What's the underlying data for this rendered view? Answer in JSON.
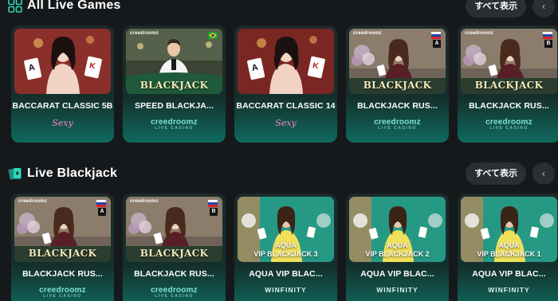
{
  "sections": [
    {
      "title": "All Live Games",
      "icon": "grid-icon",
      "see_all": "すべて表示",
      "nav": "‹",
      "cards": [
        {
          "title": "BACCARAT CLASSIC 5B",
          "provider": "Sexy",
          "provider_type": "sexy",
          "scene": "baccarat"
        },
        {
          "title": "SPEED BLACKJA...",
          "provider": "creedroomz",
          "provider_sub": "LIVE CASINO",
          "provider_type": "creed",
          "scene": "blackjack-dealer",
          "thumb_brand": "creedroomz",
          "flag": "brazil",
          "thumb_logo": "BLACKJACK"
        },
        {
          "title": "BACCARAT CLASSIC 14",
          "provider": "Sexy",
          "provider_type": "sexy",
          "scene": "baccarat2"
        },
        {
          "title": "BLACKJACK RUS...",
          "provider": "creedroomz",
          "provider_sub": "LIVE CASINO",
          "provider_type": "creed",
          "scene": "blackjack-lady",
          "thumb_brand": "creedroomz",
          "flag": "russia",
          "badge": "A",
          "thumb_logo": "BLACKJACK"
        },
        {
          "title": "BLACKJACK RUS...",
          "provider": "creedroomz",
          "provider_sub": "LIVE CASINO",
          "provider_type": "creed",
          "scene": "blackjack-lady",
          "thumb_brand": "creedroomz",
          "flag": "russia",
          "badge": "B",
          "thumb_logo": "BLACKJACK"
        }
      ]
    },
    {
      "title": "Live Blackjack",
      "icon": "cards-icon",
      "see_all": "すべて表示",
      "nav": "‹",
      "cards": [
        {
          "title": "BLACKJACK RUS...",
          "provider": "creedroomz",
          "provider_sub": "LIVE CASINO",
          "provider_type": "creed",
          "scene": "blackjack-lady",
          "thumb_brand": "creedroomz",
          "flag": "russia",
          "badge": "A",
          "thumb_logo": "BLACKJACK"
        },
        {
          "title": "BLACKJACK RUS...",
          "provider": "creedroomz",
          "provider_sub": "LIVE CASINO",
          "provider_type": "creed",
          "scene": "blackjack-lady",
          "thumb_brand": "creedroomz",
          "flag": "russia",
          "badge": "B",
          "thumb_logo": "BLACKJACK"
        },
        {
          "title": "AQUA VIP BLAC...",
          "provider": "WINFINITY",
          "provider_type": "inf",
          "scene": "aqua",
          "aqua_line1": "AQUA",
          "aqua_line2": "VIP BLACKJACK 3"
        },
        {
          "title": "AQUA VIP BLAC...",
          "provider": "WINFINITY",
          "provider_type": "inf",
          "scene": "aqua",
          "aqua_line1": "AQUA",
          "aqua_line2": "VIP BLACKJACK 2"
        },
        {
          "title": "AQUA VIP BLAC...",
          "provider": "WINFINITY",
          "provider_type": "inf",
          "scene": "aqua",
          "aqua_line1": "AQUA",
          "aqua_line2": "VIP BLACKJACK 1"
        }
      ]
    }
  ],
  "colors": {
    "background": "#16191c",
    "button_bg": "#2b2f34",
    "accent_teal": "#0f6a5e",
    "accent_icon": "#2fd4b8"
  }
}
